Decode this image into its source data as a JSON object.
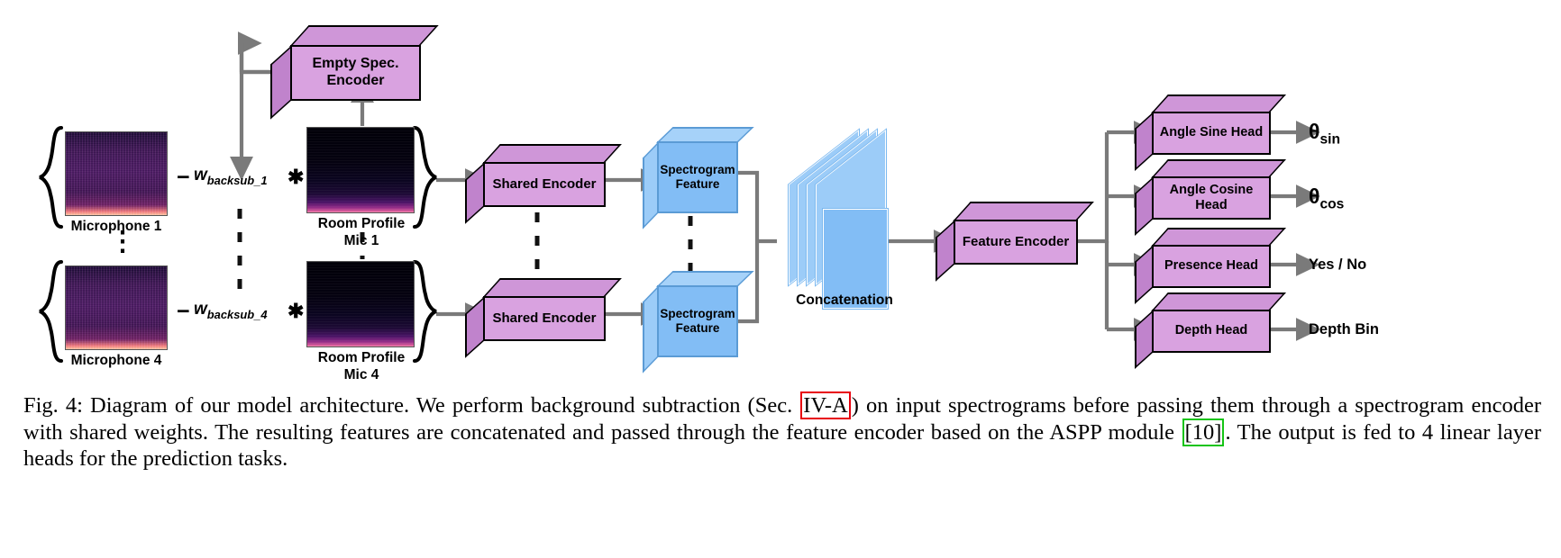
{
  "figure": {
    "title": "Diagram of our model architecture",
    "number": "Fig. 4",
    "accent_red": "#e8000d",
    "accent_green": "#15c415",
    "box_purple": "#d9a2e0",
    "box_blue": "#82bdf5",
    "arrow_gray": "#7a7a7a"
  },
  "inputs": [
    {
      "label": "Microphone 1",
      "kind": "mic-spectrogram"
    },
    {
      "label": "Microphone 4",
      "kind": "mic-spectrogram"
    }
  ],
  "dots_label": "⋮",
  "operators": [
    {
      "minus": "−",
      "weight": "w",
      "weight_sub": "backsub_1",
      "times": "✱"
    },
    {
      "minus": "−",
      "weight": "w",
      "weight_sub": "backsub_4",
      "times": "✱"
    }
  ],
  "room_profiles": [
    {
      "label": "Room Profile\nMic 1"
    },
    {
      "label": "Room Profile\nMic 4"
    }
  ],
  "modules": {
    "empty_spec_encoder": "Empty Spec.\nEncoder",
    "shared_encoder_1": "Shared Encoder",
    "shared_encoder_4": "Shared Encoder",
    "spectrogram_feature_1": "Spectrogram\nFeature",
    "spectrogram_feature_4": "Spectrogram\nFeature",
    "concatenation": "Concatenation",
    "feature_encoder": "Feature Encoder"
  },
  "heads": [
    {
      "name": "Angle Sine\nHead",
      "output_main": "θ",
      "output_sub": "sin",
      "output_plain": ""
    },
    {
      "name": "Angle Cosine\nHead",
      "output_main": "θ",
      "output_sub": "cos",
      "output_plain": ""
    },
    {
      "name": "Presence Head",
      "output_main": "",
      "output_sub": "",
      "output_plain": "Yes / No"
    },
    {
      "name": "Depth Head",
      "output_main": "",
      "output_sub": "",
      "output_plain": "Depth Bin"
    }
  ],
  "caption": {
    "part1": "Fig. 4: Diagram of our model architecture. We perform background subtraction (Sec. ",
    "ref_red": "IV-A",
    "part2": ") on input spectrograms before passing them through a spectrogram encoder with shared weights. The resulting features are concatenated and passed through the feature encoder based on the ASPP module ",
    "ref_green": "[10]",
    "part3": ". The output is fed to 4 linear layer heads for the prediction tasks."
  }
}
